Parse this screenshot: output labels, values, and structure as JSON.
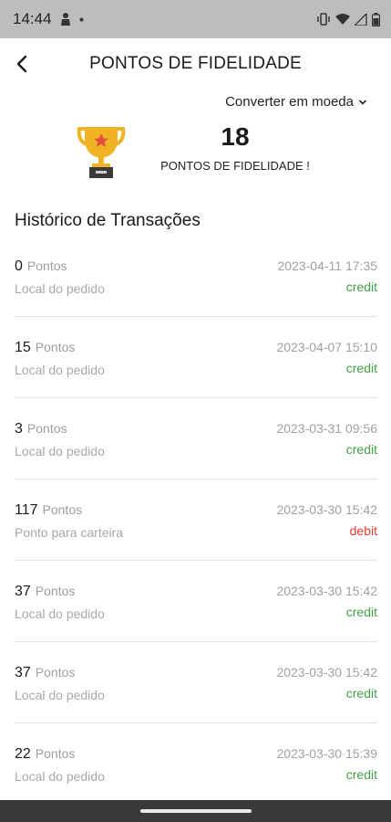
{
  "status_bar": {
    "time": "14:44",
    "icons": [
      "person-notification-icon",
      "dot-icon",
      "vibrate-icon",
      "wifi-icon",
      "signal-icon",
      "battery-icon"
    ]
  },
  "header": {
    "title": "PONTOS DE FIDELIDADE",
    "back_icon": "chevron-left-icon"
  },
  "convert": {
    "label": "Converter em moeda",
    "icon": "chevron-down-icon"
  },
  "summary": {
    "points": "18",
    "caption": "PONTOS DE FIDELIDADE !",
    "icon": "trophy-icon",
    "colors": {
      "gold": "#f0b323",
      "base": "#3a3a3a",
      "star": "#e74c3c"
    }
  },
  "history": {
    "title": "Histórico de Transações",
    "unit": "Pontos",
    "items": [
      {
        "points": "0",
        "date": "2023-04-11 17:35",
        "description": "Local do pedido",
        "type": "credit"
      },
      {
        "points": "15",
        "date": "2023-04-07 15:10",
        "description": "Local do pedido",
        "type": "credit"
      },
      {
        "points": "3",
        "date": "2023-03-31 09:56",
        "description": "Local do pedido",
        "type": "credit"
      },
      {
        "points": "117",
        "date": "2023-03-30 15:42",
        "description": "Ponto para carteira",
        "type": "debit"
      },
      {
        "points": "37",
        "date": "2023-03-30 15:42",
        "description": "Local do pedido",
        "type": "credit"
      },
      {
        "points": "37",
        "date": "2023-03-30 15:42",
        "description": "Local do pedido",
        "type": "credit"
      },
      {
        "points": "22",
        "date": "2023-03-30 15:39",
        "description": "Local do pedido",
        "type": "credit"
      }
    ]
  },
  "colors": {
    "credit": "#43a047",
    "debit": "#e53935"
  }
}
